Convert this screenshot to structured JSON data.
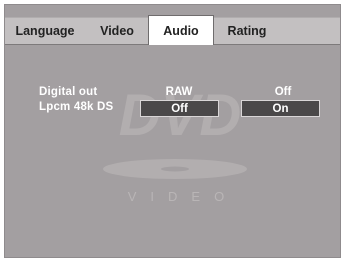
{
  "tabs": [
    {
      "label": "Language",
      "active": false
    },
    {
      "label": "Video",
      "active": false
    },
    {
      "label": "Audio",
      "active": true
    },
    {
      "label": "Rating",
      "active": false
    }
  ],
  "settings": [
    {
      "label": "Digital out",
      "value_1": "RAW",
      "value_2": "Off"
    },
    {
      "label": "Lpcm 48k DS",
      "value_1": "Off",
      "value_2": "On"
    }
  ],
  "watermark": {
    "logo_text": "DVD",
    "sub_text": "VIDEO"
  },
  "colors": {
    "panel_background": "#a39fa1",
    "tab_bar": "#c3c0c1",
    "active_tab": "#ffffff",
    "selected_cell": "#4a4849",
    "text_light": "#ffffff",
    "text_dark": "#222222"
  }
}
